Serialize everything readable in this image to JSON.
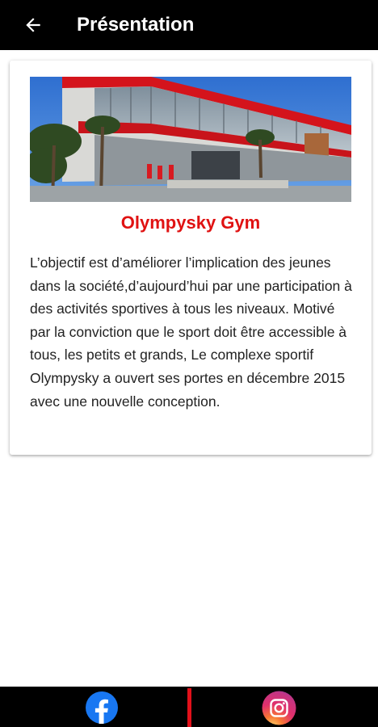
{
  "appbar": {
    "title": "Présentation",
    "background": "#000000",
    "back_icon": "arrow-left-icon"
  },
  "card": {
    "image_desc": "gym-building-photo",
    "title": "Olympysky Gym",
    "title_color": "#e01212",
    "body": "L’objectif est d’améliorer l’implication des jeunes dans la société,d’aujourd’hui par une participation à des activités sportives à tous les niveaux. Motivé par la conviction que le sport doit être accessible à tous, les petits et grands, Le complexe sportif Olympysky a ouvert ses portes en décembre 2015 avec une nouvelle conception."
  },
  "bottom_bar": {
    "background": "#000000",
    "divider_color": "#e2101a",
    "icons": [
      "facebook-icon",
      "instagram-icon"
    ]
  }
}
